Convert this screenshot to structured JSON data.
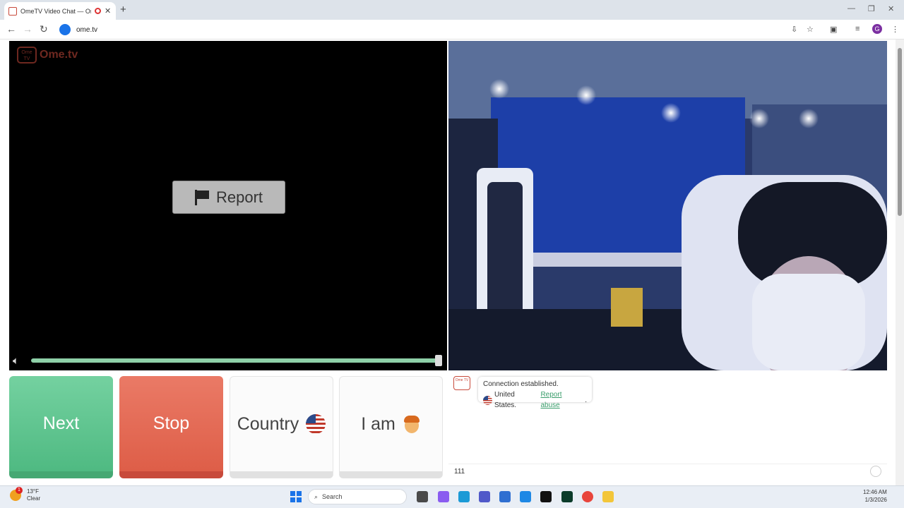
{
  "browser": {
    "tab_title": "OmeTV Video Chat — Ome",
    "tab_close": "✕",
    "new_tab": "+",
    "url": "ome.tv",
    "window_controls": {
      "minimize": "—",
      "restore": "❐",
      "close": "✕"
    },
    "profile_initial": "G"
  },
  "video": {
    "logo_text": "Ome.tv",
    "logo_badge": "Ome TV",
    "report_label": "Report",
    "volume_level": 1.0
  },
  "controls": {
    "next_label": "Next",
    "stop_label": "Stop",
    "country_label": "Country",
    "iam_label": "I am"
  },
  "chat": {
    "status_message": "Connection established.",
    "country": "United States.",
    "report_link": "Report abuse",
    "input_value": "111",
    "logo_badge": "Ome TV"
  },
  "taskbar": {
    "temperature": "13°F",
    "condition": "Clear",
    "weather_badge": "1",
    "search_placeholder": "Search",
    "time": "12:46 AM",
    "date": "1/3/2026"
  },
  "colors": {
    "next": "#5cc38f",
    "stop": "#e26a55",
    "accent_green": "#3a9d6b",
    "brand_red": "#c84a3b"
  }
}
